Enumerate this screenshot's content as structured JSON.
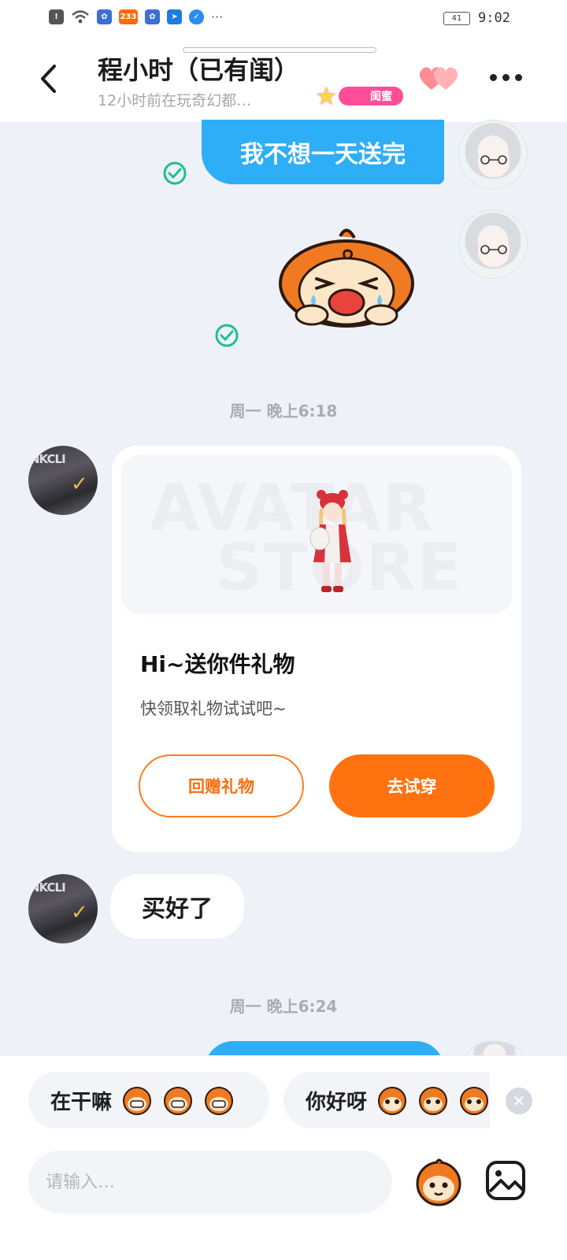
{
  "status_bar": {
    "time": "9:02",
    "battery": "41",
    "app_badge": "233",
    "more": "···"
  },
  "header": {
    "title": "程小时（已有闺）",
    "subtitle": "12小时前在玩奇幻都…",
    "relation_badge": "闺蜜",
    "accent": "#ff4d9a"
  },
  "messages": {
    "me_text_1": "我不想一天送完",
    "timestamp_1": "周一 晚上6:18",
    "gift_card": {
      "watermark_line_1": "AVATAR",
      "watermark_line_2": "STORE",
      "title": "Hi~送你件礼物",
      "desc": "快领取礼物试试吧~",
      "return_button": "回赠礼物",
      "try_button": "去试穿"
    },
    "friend_text_1": "买好了",
    "timestamp_2": "周一 晚上6:24"
  },
  "avatars": {
    "friend_brand": "NKCLI"
  },
  "quick_replies": [
    {
      "text": "在干嘛"
    },
    {
      "text": "你好呀"
    }
  ],
  "input": {
    "placeholder": "请输入…",
    "value": ""
  },
  "colors": {
    "bubble_me": "#2daef7",
    "primary_orange": "#ff720f",
    "background": "#eef1f8"
  },
  "icons": [
    "back-icon",
    "hearts-icon",
    "more-icon",
    "check-icon",
    "crying-sticker",
    "close-icon",
    "mascot-icon",
    "image-icon"
  ]
}
